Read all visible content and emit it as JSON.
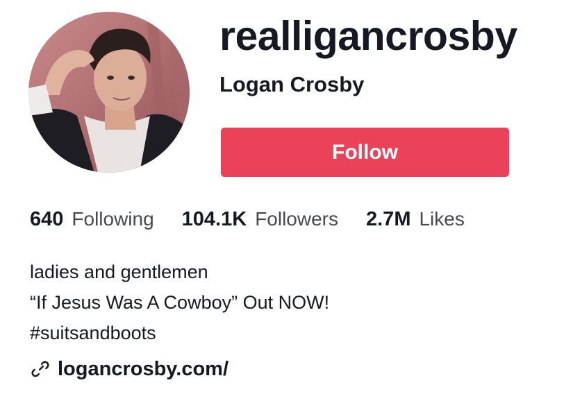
{
  "profile": {
    "username": "realligancrosby",
    "display_name": "Logan Crosby",
    "follow_label": "Follow",
    "accent_color": "#ea4359"
  },
  "stats": [
    {
      "value": "640",
      "label": "Following"
    },
    {
      "value": "104.1K",
      "label": "Followers"
    },
    {
      "value": "2.7M",
      "label": "Likes"
    }
  ],
  "bio": {
    "lines": [
      "ladies and gentlemen",
      "“If Jesus Was A Cowboy” Out NOW!",
      "#suitsandboots"
    ]
  },
  "link": {
    "icon": "link-icon",
    "text": "logancrosby.com/"
  }
}
